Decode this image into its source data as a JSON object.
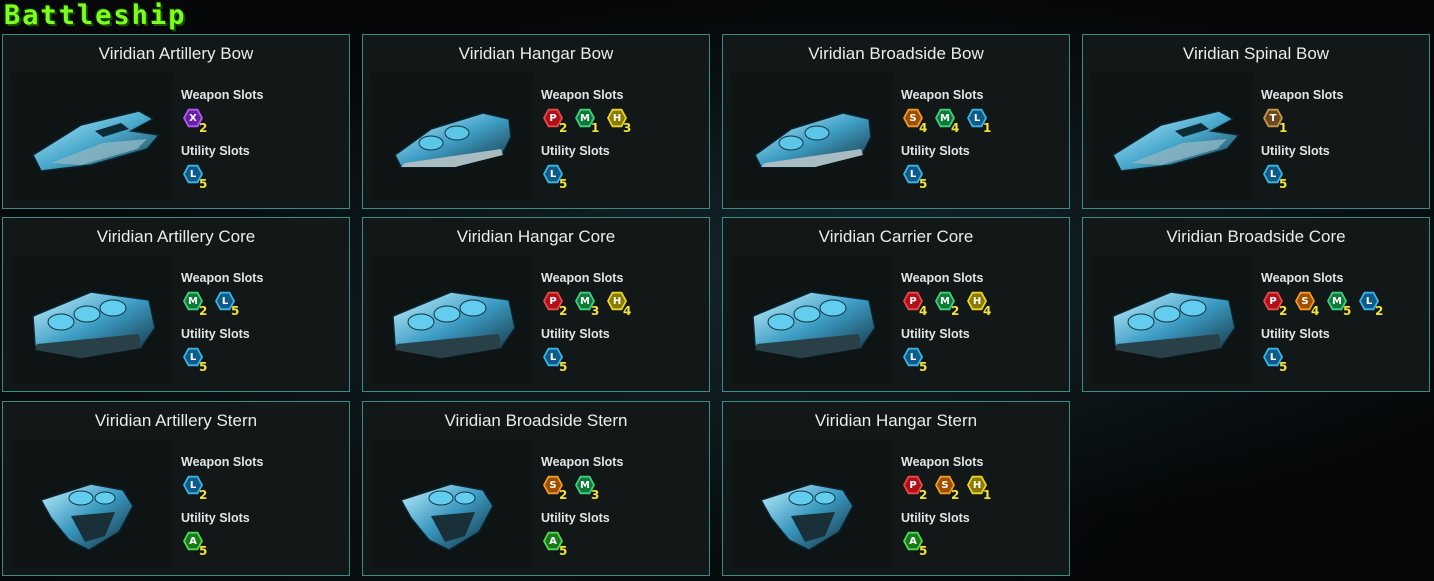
{
  "page_title": "Battleship",
  "slot_types": {
    "X": {
      "inner": "#6a1fa8",
      "ring": "#b35cf0"
    },
    "P": {
      "inner": "#b0101a",
      "ring": "#e84a4a"
    },
    "M": {
      "inner": "#0d7a3a",
      "ring": "#3fd27a"
    },
    "H": {
      "inner": "#8a7a00",
      "ring": "#e8d62a"
    },
    "S": {
      "inner": "#a04e00",
      "ring": "#f29a2a"
    },
    "L": {
      "inner": "#0f5a86",
      "ring": "#39b6e8"
    },
    "T": {
      "inner": "#6a4a1e",
      "ring": "#c89a4a"
    },
    "A": {
      "inner": "#1a7a1a",
      "ring": "#52d852"
    }
  },
  "labels": {
    "weapon": "Weapon Slots",
    "utility": "Utility Slots"
  },
  "cards": [
    {
      "name": "Viridian Artillery Bow",
      "shape": "bow-claw",
      "weapon": [
        {
          "type": "X",
          "count": "2"
        }
      ],
      "utility": [
        {
          "type": "L",
          "count": "5"
        }
      ]
    },
    {
      "name": "Viridian Hangar Bow",
      "shape": "bow-wide",
      "weapon": [
        {
          "type": "P",
          "count": "2"
        },
        {
          "type": "M",
          "count": "1"
        },
        {
          "type": "H",
          "count": "3"
        }
      ],
      "utility": [
        {
          "type": "L",
          "count": "5"
        }
      ]
    },
    {
      "name": "Viridian Broadside Bow",
      "shape": "bow-wide",
      "weapon": [
        {
          "type": "S",
          "count": "4"
        },
        {
          "type": "M",
          "count": "4"
        },
        {
          "type": "L",
          "count": "1"
        }
      ],
      "utility": [
        {
          "type": "L",
          "count": "5"
        }
      ]
    },
    {
      "name": "Viridian Spinal Bow",
      "shape": "bow-claw",
      "weapon": [
        {
          "type": "T",
          "count": "1"
        }
      ],
      "utility": [
        {
          "type": "L",
          "count": "5"
        }
      ]
    },
    {
      "name": "Viridian Artillery Core",
      "shape": "core",
      "weapon": [
        {
          "type": "M",
          "count": "2"
        },
        {
          "type": "L",
          "count": "5"
        }
      ],
      "utility": [
        {
          "type": "L",
          "count": "5"
        }
      ]
    },
    {
      "name": "Viridian Hangar Core",
      "shape": "core",
      "weapon": [
        {
          "type": "P",
          "count": "2"
        },
        {
          "type": "M",
          "count": "3"
        },
        {
          "type": "H",
          "count": "4"
        }
      ],
      "utility": [
        {
          "type": "L",
          "count": "5"
        }
      ]
    },
    {
      "name": "Viridian Carrier Core",
      "shape": "core",
      "weapon": [
        {
          "type": "P",
          "count": "4"
        },
        {
          "type": "M",
          "count": "2"
        },
        {
          "type": "H",
          "count": "4"
        }
      ],
      "utility": [
        {
          "type": "L",
          "count": "5"
        }
      ]
    },
    {
      "name": "Viridian Broadside Core",
      "shape": "core",
      "weapon": [
        {
          "type": "P",
          "count": "2"
        },
        {
          "type": "S",
          "count": "4"
        },
        {
          "type": "M",
          "count": "5"
        },
        {
          "type": "L",
          "count": "2"
        }
      ],
      "utility": [
        {
          "type": "L",
          "count": "5"
        }
      ]
    },
    {
      "name": "Viridian Artillery Stern",
      "shape": "stern",
      "weapon": [
        {
          "type": "L",
          "count": "2"
        }
      ],
      "utility": [
        {
          "type": "A",
          "count": "5"
        }
      ]
    },
    {
      "name": "Viridian Broadside Stern",
      "shape": "stern",
      "weapon": [
        {
          "type": "S",
          "count": "2"
        },
        {
          "type": "M",
          "count": "3"
        }
      ],
      "utility": [
        {
          "type": "A",
          "count": "5"
        }
      ]
    },
    {
      "name": "Viridian Hangar Stern",
      "shape": "stern",
      "weapon": [
        {
          "type": "P",
          "count": "2"
        },
        {
          "type": "S",
          "count": "2"
        },
        {
          "type": "H",
          "count": "1"
        }
      ],
      "utility": [
        {
          "type": "A",
          "count": "5"
        }
      ]
    }
  ]
}
